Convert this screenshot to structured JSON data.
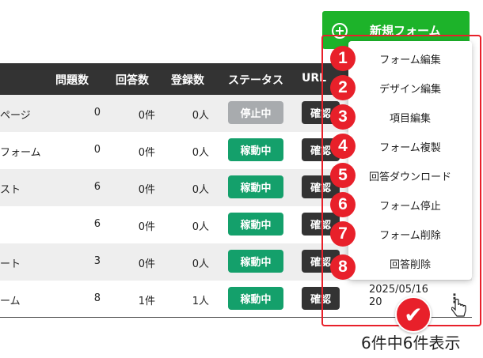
{
  "new_form_button": {
    "label": "新規フォーム"
  },
  "table": {
    "headers": {
      "questions": "問題数",
      "answers": "回答数",
      "registrations": "登録数",
      "status": "ステータス",
      "url": "URL"
    },
    "rows": [
      {
        "name": "ページ",
        "questions": "0",
        "answers": "0件",
        "registrations": "0人",
        "status": "停止中",
        "confirm": "確認"
      },
      {
        "name": "フォーム",
        "questions": "0",
        "answers": "0件",
        "registrations": "0人",
        "status": "稼動中",
        "confirm": "確認"
      },
      {
        "name": "スト",
        "questions": "6",
        "answers": "0件",
        "registrations": "0人",
        "status": "稼動中",
        "confirm": "確認"
      },
      {
        "name": "",
        "questions": "6",
        "answers": "0件",
        "registrations": "0人",
        "status": "稼動中",
        "confirm": "確認"
      },
      {
        "name": "ート",
        "questions": "3",
        "answers": "0件",
        "registrations": "0人",
        "status": "稼動中",
        "confirm": "確認"
      },
      {
        "name": "ーム",
        "questions": "8",
        "answers": "1件",
        "registrations": "1人",
        "status": "稼動中",
        "confirm": "確認",
        "date_line1": "2025/05/16",
        "date_line2": "20"
      }
    ]
  },
  "menu": {
    "items": [
      {
        "number": "1",
        "label": "フォーム編集"
      },
      {
        "number": "2",
        "label": "デザイン編集"
      },
      {
        "number": "3",
        "label": "項目編集"
      },
      {
        "number": "4",
        "label": "フォーム複製"
      },
      {
        "number": "5",
        "label": "回答ダウンロード"
      },
      {
        "number": "6",
        "label": "フォーム停止"
      },
      {
        "number": "7",
        "label": "フォーム削除"
      },
      {
        "number": "8",
        "label": "回答削除"
      }
    ]
  },
  "count_text": "6件中6件表示",
  "icons": {
    "new_form": "plus-circle-icon",
    "more": "kebab-icon",
    "check": "check-icon",
    "cursor": "hand-cursor-icon"
  },
  "colors": {
    "accent_green": "#1db32a",
    "active_badge": "#14a06b",
    "stopped_badge": "#a8abae",
    "header_bg": "#333333",
    "highlight_red": "#e8202a"
  }
}
